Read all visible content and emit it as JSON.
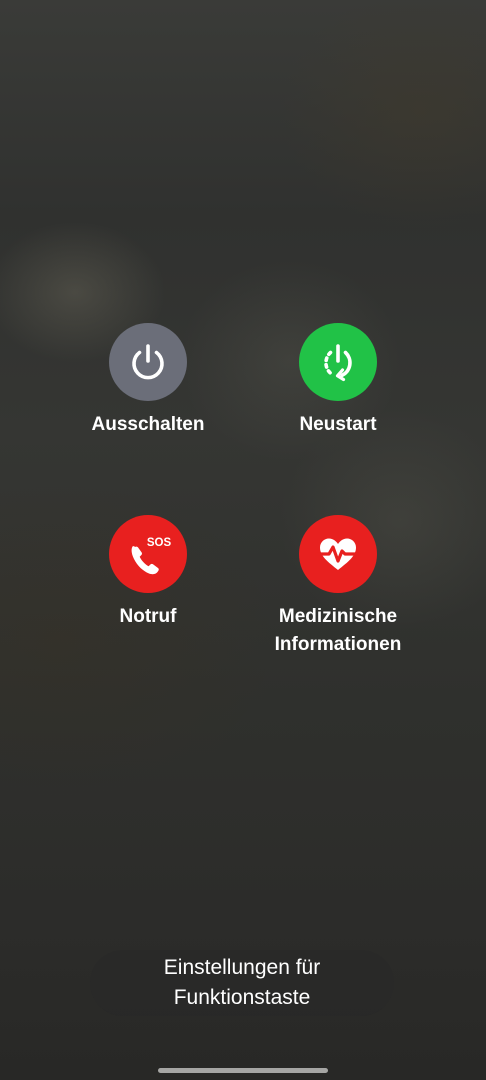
{
  "colors": {
    "power": "#6b6e79",
    "restart": "#21c247",
    "sos": "#e8201f",
    "medical": "#e8201f",
    "text": "#ffffff"
  },
  "actions": {
    "power": {
      "label": "Ausschalten",
      "icon": "power-icon"
    },
    "restart": {
      "label": "Neustart",
      "icon": "restart-icon"
    },
    "sos": {
      "label": "Notruf",
      "icon": "phone-sos-icon",
      "badge": "SOS"
    },
    "medical": {
      "label": "Medizinische\nInformationen",
      "icon": "heart-pulse-icon"
    }
  },
  "settings_button": {
    "label": "Einstellungen für\nFunktionstaste"
  }
}
